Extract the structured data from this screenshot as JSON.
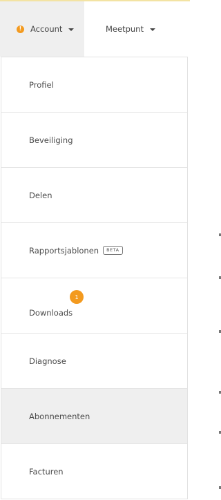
{
  "navbar": {
    "account": {
      "alert_icon_glyph": "!",
      "alert_color": "#f39a1f",
      "label": "Account",
      "icon": "chevron-down-icon"
    },
    "meetpunt": {
      "label": "Meetpunt",
      "icon": "chevron-down-icon"
    }
  },
  "dropdown": {
    "items": [
      {
        "label": "Profiel"
      },
      {
        "label": "Beveiliging"
      },
      {
        "label": "Delen"
      },
      {
        "label": "Rapportsjablonen",
        "badge": "BETA"
      },
      {
        "label": "Downloads",
        "count": "1"
      },
      {
        "label": "Diagnose"
      },
      {
        "label": "Abonnementen",
        "active": true
      },
      {
        "label": "Facturen"
      }
    ]
  },
  "colors": {
    "accent": "#f39a1f",
    "active_bg": "#efefef",
    "top_border": "#f3e3a3"
  }
}
